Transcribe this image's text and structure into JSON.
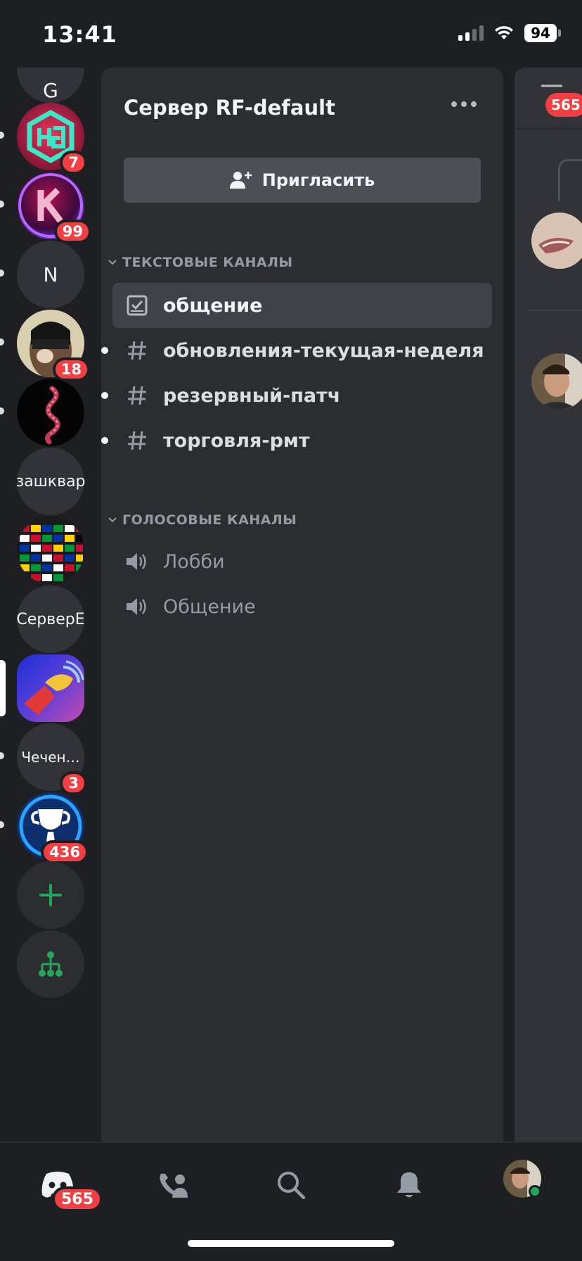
{
  "status": {
    "time": "13:41",
    "battery": "94"
  },
  "servers": [
    {
      "name": "G",
      "badge": ""
    },
    {
      "name": "hg-server",
      "badge": "7"
    },
    {
      "name": "k-server",
      "badge": "99"
    },
    {
      "name": "N",
      "badge": ""
    },
    {
      "name": "avatar-server",
      "badge": "18"
    },
    {
      "name": "snake-server",
      "badge": ""
    },
    {
      "name": "зашквар",
      "badge": ""
    },
    {
      "name": "flags-server",
      "badge": ""
    },
    {
      "name": "СерверE",
      "badge": ""
    },
    {
      "name": "selected-server",
      "badge": ""
    },
    {
      "name": "Чечен…",
      "badge": "3"
    },
    {
      "name": "trophy-server",
      "badge": "436"
    }
  ],
  "panel": {
    "title": "Сервер RF-default",
    "invite_label": "Пригласить",
    "text_category": "ТЕКСТОВЫЕ КАНАЛЫ",
    "voice_category": "ГОЛОСОВЫЕ КАНАЛЫ",
    "text_channels": [
      "общение",
      "обновления-текущая-неделя",
      "резервный-патч",
      "торговля-рмт"
    ],
    "voice_channels": [
      "Лобби",
      "Общение"
    ]
  },
  "chat_peek": {
    "badge": "565"
  },
  "tabs": {
    "home_badge": "565"
  },
  "colors": {
    "accent_red": "#f23f43",
    "online": "#23a55a",
    "green_icon": "#23a55a"
  }
}
